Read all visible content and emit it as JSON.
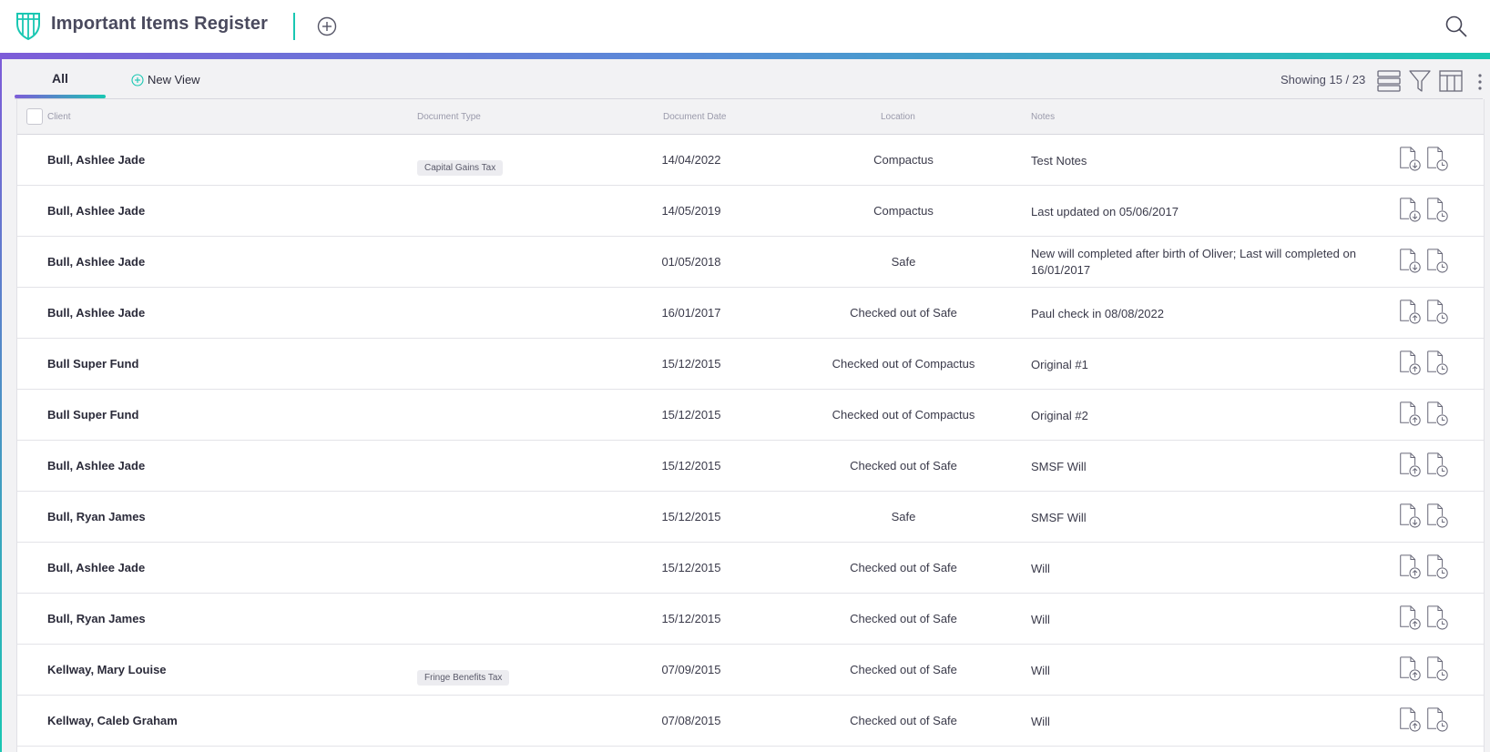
{
  "header": {
    "title": "Important Items Register",
    "icons": {
      "logo": "shield-logo",
      "add": "plus-circle-icon",
      "search": "search-icon"
    }
  },
  "colors": {
    "accent_purple": "#7d5cd8",
    "accent_teal": "#19c7b2",
    "text_dark": "#2b2b3a",
    "background": "#f2f2f4"
  },
  "views": {
    "active_tab": "All",
    "new_view_label": "New View",
    "showing": "Showing 15 / 23",
    "toolbar_icons": [
      "row-density-icon",
      "filter-icon",
      "columns-icon",
      "more-options-icon"
    ]
  },
  "table": {
    "columns": [
      "Client",
      "Document Type",
      "Document Date",
      "Location",
      "Notes"
    ],
    "rows": [
      {
        "client": "Bull, Ashlee Jade",
        "doc_type": "Capital Gains Tax",
        "date": "14/04/2022",
        "location": "Compactus",
        "notes": "Test Notes",
        "file_action": "download"
      },
      {
        "client": "Bull, Ashlee Jade",
        "doc_type": "",
        "date": "14/05/2019",
        "location": "Compactus",
        "notes": "Last updated on 05/06/2017",
        "file_action": "download"
      },
      {
        "client": "Bull, Ashlee Jade",
        "doc_type": "",
        "date": "01/05/2018",
        "location": "Safe",
        "notes": "New will completed after birth of Oliver; Last will completed on 16/01/2017",
        "file_action": "download"
      },
      {
        "client": "Bull, Ashlee Jade",
        "doc_type": "",
        "date": "16/01/2017",
        "location": "Checked out of Safe",
        "notes": "Paul check in 08/08/2022",
        "file_action": "upload"
      },
      {
        "client": "Bull Super Fund",
        "doc_type": "",
        "date": "15/12/2015",
        "location": "Checked out of Compactus",
        "notes": "Original #1",
        "file_action": "upload"
      },
      {
        "client": "Bull Super Fund",
        "doc_type": "",
        "date": "15/12/2015",
        "location": "Checked out of Compactus",
        "notes": "Original #2",
        "file_action": "upload"
      },
      {
        "client": "Bull, Ashlee Jade",
        "doc_type": "",
        "date": "15/12/2015",
        "location": "Checked out of Safe",
        "notes": "SMSF Will",
        "file_action": "upload"
      },
      {
        "client": "Bull, Ryan James",
        "doc_type": "",
        "date": "15/12/2015",
        "location": "Safe",
        "notes": "SMSF Will",
        "file_action": "download"
      },
      {
        "client": "Bull, Ashlee Jade",
        "doc_type": "",
        "date": "15/12/2015",
        "location": "Checked out of Safe",
        "notes": "Will",
        "file_action": "upload"
      },
      {
        "client": "Bull, Ryan James",
        "doc_type": "",
        "date": "15/12/2015",
        "location": "Checked out of Safe",
        "notes": "Will",
        "file_action": "upload"
      },
      {
        "client": "Kellway, Mary Louise",
        "doc_type": "Fringe Benefits Tax",
        "date": "07/09/2015",
        "location": "Checked out of Safe",
        "notes": "Will",
        "file_action": "upload"
      },
      {
        "client": "Kellway, Caleb Graham",
        "doc_type": "",
        "date": "07/08/2015",
        "location": "Checked out of Safe",
        "notes": "Will",
        "file_action": "upload"
      }
    ]
  }
}
